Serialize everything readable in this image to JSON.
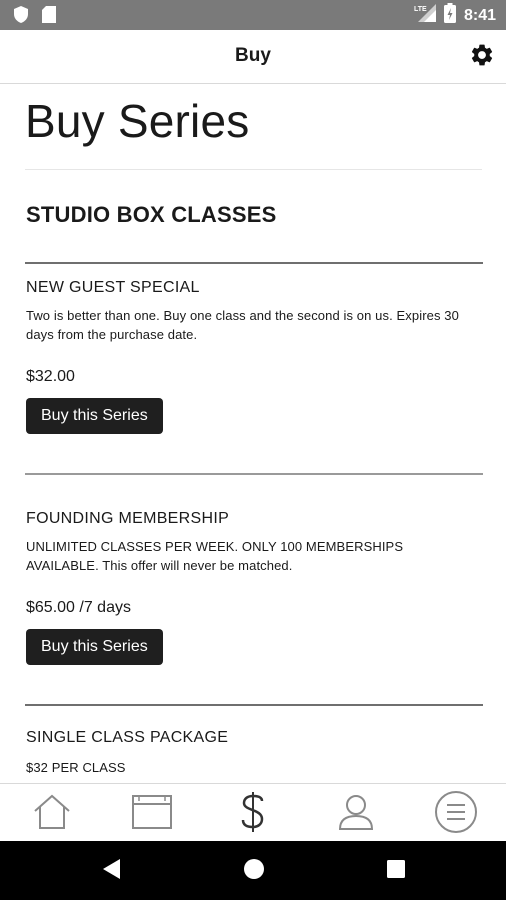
{
  "status_bar": {
    "time": "8:41",
    "network": "LTE",
    "icons": [
      "shield-icon",
      "sd-card-icon",
      "signal-icon",
      "battery-icon"
    ]
  },
  "app_bar": {
    "title": "Buy",
    "settings_icon": "gear-icon"
  },
  "page": {
    "title": "Buy Series",
    "section_heading": "STUDIO BOX CLASSES",
    "series": [
      {
        "name": "NEW GUEST SPECIAL",
        "description": "Two is better than one. Buy one class and the second is on us. Expires 30 days from the purchase date.",
        "price": "$32.00",
        "button_label": "Buy this Series"
      },
      {
        "name": "FOUNDING MEMBERSHIP",
        "description": "UNLIMITED CLASSES PER WEEK. ONLY 100 MEMBERSHIPS AVAILABLE. This offer will never be matched.",
        "price": "$65.00 /7 days",
        "button_label": "Buy this Series"
      },
      {
        "name": "SINGLE CLASS PACKAGE",
        "description": "$32 PER CLASS"
      }
    ]
  },
  "bottom_nav": {
    "items": [
      {
        "icon": "home-icon"
      },
      {
        "icon": "calendar-icon"
      },
      {
        "icon": "dollar-icon",
        "active": true
      },
      {
        "icon": "profile-icon"
      },
      {
        "icon": "menu-icon"
      }
    ]
  },
  "system_nav": {
    "buttons": [
      "back-icon",
      "home-circle-icon",
      "recents-icon"
    ]
  },
  "colors": {
    "status_bar": "#7a7a7a",
    "button_bg": "#1f1f1f",
    "rule": "#6f6f6f",
    "icon_gray": "#8a8a8a"
  }
}
